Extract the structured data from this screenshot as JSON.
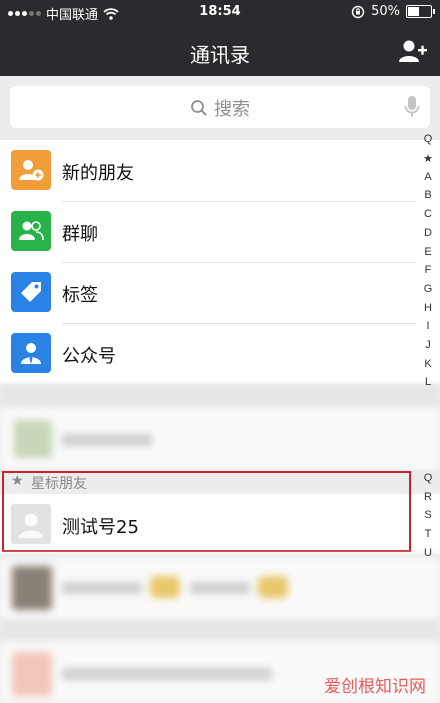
{
  "status_bar": {
    "carrier": "中国联通",
    "time": "18:54",
    "battery": "50%",
    "battery_level": 0.5
  },
  "nav": {
    "title": "通讯录"
  },
  "search": {
    "placeholder": "搜索"
  },
  "entries": [
    {
      "label": "新的朋友",
      "icon": "add-friend-icon",
      "color": "#f19d38"
    },
    {
      "label": "群聊",
      "icon": "group-chat-icon",
      "color": "#27b24a"
    },
    {
      "label": "标签",
      "icon": "tag-icon",
      "color": "#2a82e4"
    },
    {
      "label": "公众号",
      "icon": "official-account-icon",
      "color": "#2a82e4"
    }
  ],
  "starred": {
    "header": "星标朋友",
    "contact_name": "测试号25"
  },
  "index_letters": [
    "Q",
    "★",
    "A",
    "B",
    "C",
    "D",
    "E",
    "F",
    "G",
    "H",
    "I",
    "J",
    "K",
    "L",
    "Q",
    "R",
    "S",
    "T",
    "U"
  ],
  "watermark": "爱创根知识网",
  "colors": {
    "bar": "#2a2b2f",
    "highlight": "#c8242b"
  }
}
